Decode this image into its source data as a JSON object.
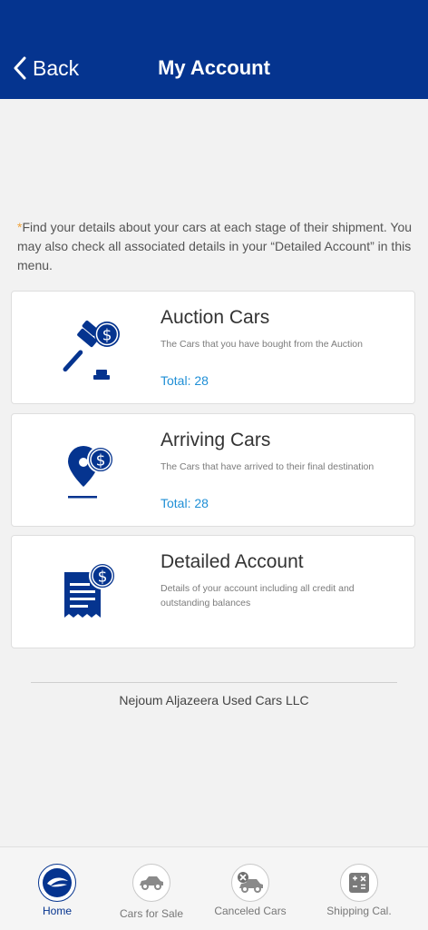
{
  "header": {
    "back_label": "Back",
    "title": "My Account"
  },
  "intro": {
    "star": "*",
    "text": "Find your details about your cars at each stage of their shipment. You may also check all associated details in your “Detailed Account” in this menu."
  },
  "cards": [
    {
      "title": "Auction Cars",
      "description": "The Cars that you have bought from the Auction",
      "total": "Total: 28",
      "icon": "auction-gavel-dollar-icon"
    },
    {
      "title": "Arriving Cars",
      "description": "The Cars that have arrived to their final destination",
      "total": "Total: 28",
      "icon": "location-pin-dollar-icon"
    },
    {
      "title": "Detailed Account",
      "description": "Details of your account including all credit and outstanding balances",
      "icon": "receipt-dollar-icon"
    }
  ],
  "footer": {
    "company": "Nejoum Aljazeera Used Cars LLC"
  },
  "tabbar": {
    "items": [
      {
        "label": "Home",
        "icon": "home-logo-icon",
        "active": true
      },
      {
        "label": "Cars for Sale",
        "icon": "car-icon",
        "active": false
      },
      {
        "label": "Canceled Cars",
        "icon": "canceled-car-icon",
        "active": false
      },
      {
        "label": "Shipping Cal.",
        "icon": "calculator-icon",
        "active": false
      }
    ]
  },
  "colors": {
    "brand_blue": "#05348f",
    "accent_link": "#1f8fd6",
    "star": "#f0a23a",
    "background": "#f2f2f2"
  }
}
